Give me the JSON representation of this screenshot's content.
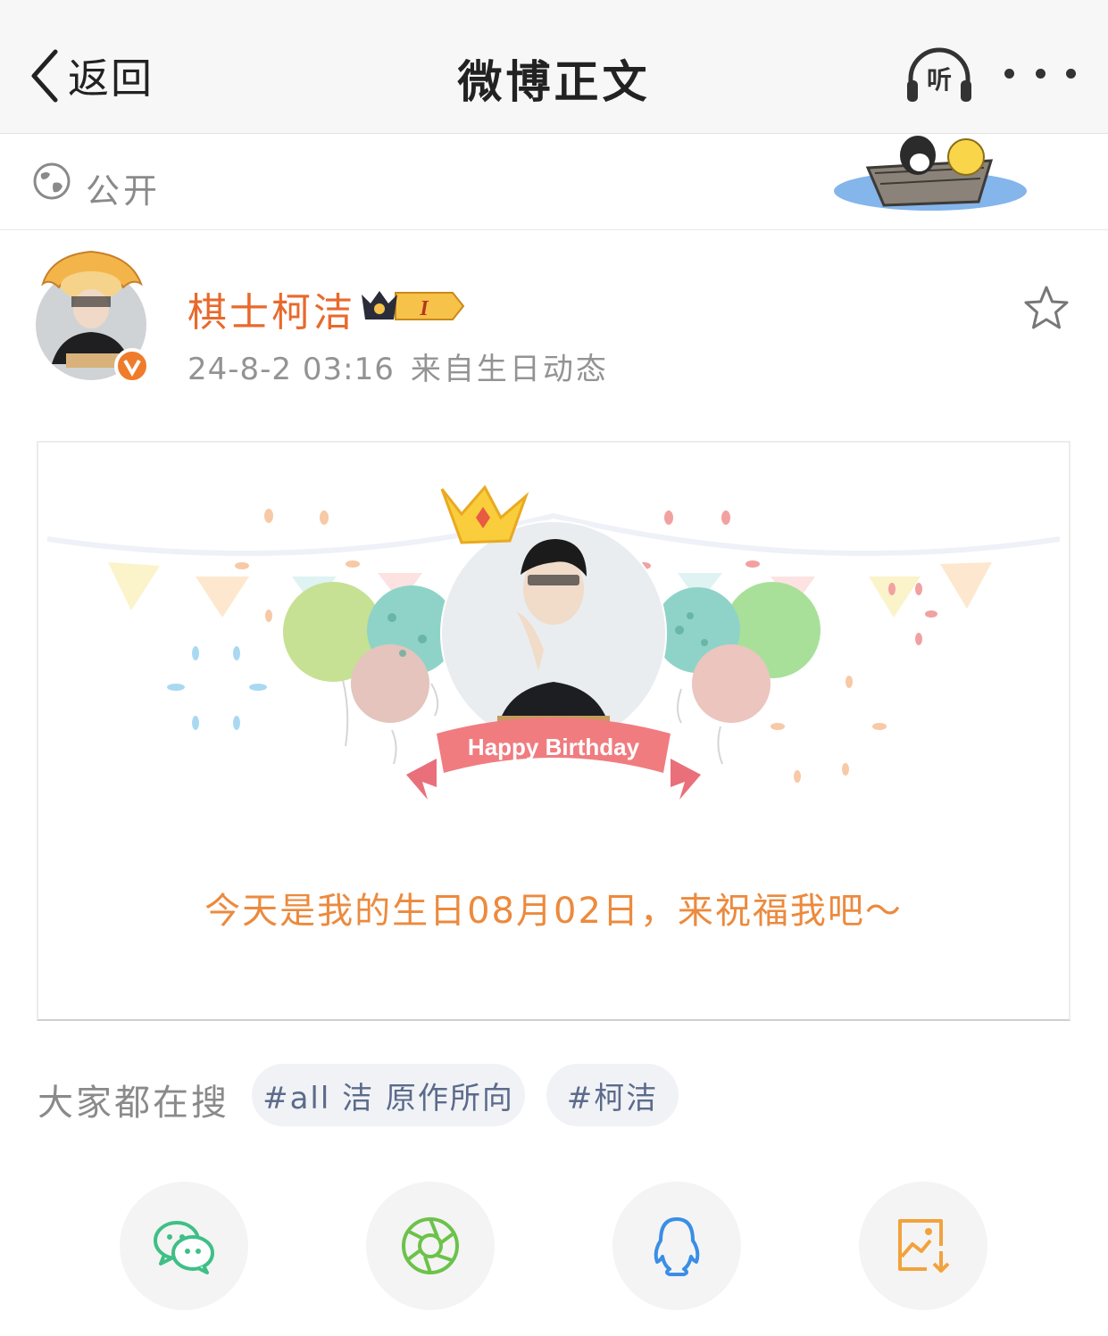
{
  "nav": {
    "back_label": "返回",
    "title": "微博正文",
    "listen_label": "听"
  },
  "visibility": {
    "label": "公开"
  },
  "post": {
    "author": "棋士柯洁",
    "vip_level": "I",
    "timestamp": "24-8-2 03:16",
    "source": "来自生日动态"
  },
  "card": {
    "banner_text": "Happy Birthday",
    "message": "今天是我的生日08月02日，来祝福我吧～"
  },
  "trending": {
    "label": "大家都在搜",
    "tags": [
      "#all 洁 原作所向",
      "#柯洁"
    ]
  },
  "share": {
    "icons": [
      "wechat-icon",
      "moments-icon",
      "qq-icon",
      "save-image-icon"
    ]
  },
  "colors": {
    "username": "#e8692c",
    "message": "#ec8a3d",
    "wechat": "#3fbf86",
    "moments": "#6cc24a",
    "qq": "#3a8ee6",
    "save": "#f2a23c",
    "tag_text": "#5c6b8a"
  }
}
